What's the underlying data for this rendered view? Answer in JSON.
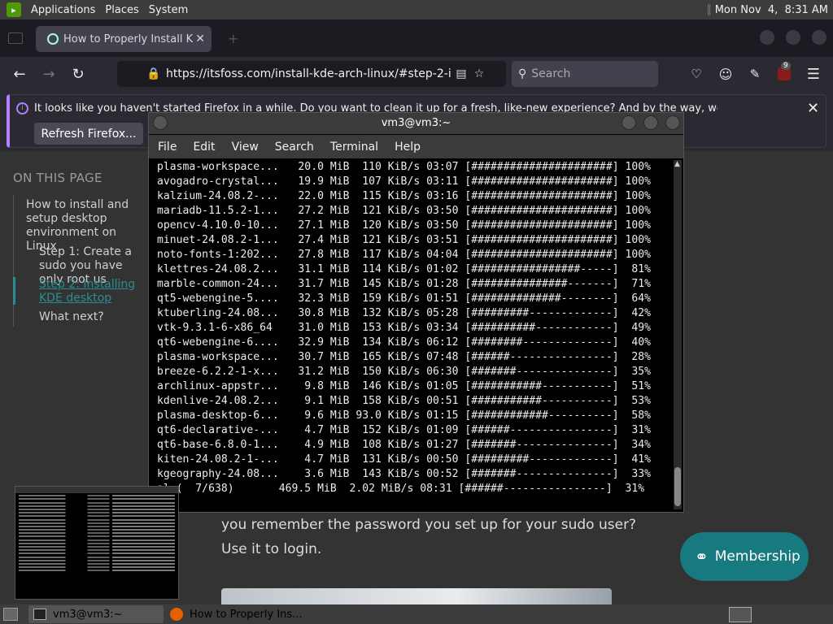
{
  "top_panel": {
    "menus": [
      "Applications",
      "Places",
      "System"
    ],
    "clock": "Mon Nov  4,  8:31 AM"
  },
  "browser": {
    "tab_title": "How to Properly Install KDE",
    "url": "https://itsfoss.com/install-kde-arch-linux/#step-2-instal",
    "search_placeholder": "Search",
    "badge_count": "9",
    "notification": "It looks like you haven't started Firefox in a while. Do you want to clean it up for a fresh, like-new experience? And by the way, welcome back!",
    "refresh_button": "Refresh Firefox..."
  },
  "page": {
    "toc_heading": "ON THIS PAGE",
    "toc_items": [
      "How to install and setup desktop environment on Linux",
      "Step 1: Create a sudo you have only root us",
      "Step 2: Installing KDE desktop",
      "What next?"
    ],
    "body_line1": "you remember the password you set up for your sudo user?",
    "body_line2": "Use it to login.",
    "membership_label": "Membership"
  },
  "terminal": {
    "title": "vm3@vm3:~",
    "menu": [
      "File",
      "Edit",
      "View",
      "Search",
      "Terminal",
      "Help"
    ],
    "lines": [
      {
        "name": "plasma-workspace...",
        "size": "20.0 MiB",
        "speed": "110 KiB/s",
        "eta": "03:07",
        "bar": "[######################]",
        "pct": "100%"
      },
      {
        "name": "avogadro-crystal...",
        "size": "19.9 MiB",
        "speed": "107 KiB/s",
        "eta": "03:11",
        "bar": "[######################]",
        "pct": "100%"
      },
      {
        "name": "kalzium-24.08.2-...",
        "size": "22.0 MiB",
        "speed": "115 KiB/s",
        "eta": "03:16",
        "bar": "[######################]",
        "pct": "100%"
      },
      {
        "name": "mariadb-11.5.2-1...",
        "size": "27.2 MiB",
        "speed": "121 KiB/s",
        "eta": "03:50",
        "bar": "[######################]",
        "pct": "100%"
      },
      {
        "name": "opencv-4.10.0-10...",
        "size": "27.1 MiB",
        "speed": "120 KiB/s",
        "eta": "03:50",
        "bar": "[######################]",
        "pct": "100%"
      },
      {
        "name": "minuet-24.08.2-1...",
        "size": "27.4 MiB",
        "speed": "121 KiB/s",
        "eta": "03:51",
        "bar": "[######################]",
        "pct": "100%"
      },
      {
        "name": "noto-fonts-1:202...",
        "size": "27.8 MiB",
        "speed": "117 KiB/s",
        "eta": "04:04",
        "bar": "[######################]",
        "pct": "100%"
      },
      {
        "name": "klettres-24.08.2...",
        "size": "31.1 MiB",
        "speed": "114 KiB/s",
        "eta": "01:02",
        "bar": "[#################-----]",
        "pct": "81%"
      },
      {
        "name": "marble-common-24...",
        "size": "31.7 MiB",
        "speed": "145 KiB/s",
        "eta": "01:28",
        "bar": "[###############-------]",
        "pct": "71%"
      },
      {
        "name": "qt5-webengine-5....",
        "size": "32.3 MiB",
        "speed": "159 KiB/s",
        "eta": "01:51",
        "bar": "[##############--------]",
        "pct": "64%"
      },
      {
        "name": "ktuberling-24.08...",
        "size": "30.8 MiB",
        "speed": "132 KiB/s",
        "eta": "05:28",
        "bar": "[#########-------------]",
        "pct": "42%"
      },
      {
        "name": "vtk-9.3.1-6-x86_64",
        "size": "31.0 MiB",
        "speed": "153 KiB/s",
        "eta": "03:34",
        "bar": "[##########------------]",
        "pct": "49%"
      },
      {
        "name": "qt6-webengine-6....",
        "size": "32.9 MiB",
        "speed": "134 KiB/s",
        "eta": "06:12",
        "bar": "[########--------------]",
        "pct": "40%"
      },
      {
        "name": "plasma-workspace...",
        "size": "30.7 MiB",
        "speed": "165 KiB/s",
        "eta": "07:48",
        "bar": "[######----------------]",
        "pct": "28%"
      },
      {
        "name": "breeze-6.2.2-1-x...",
        "size": "31.2 MiB",
        "speed": "150 KiB/s",
        "eta": "06:30",
        "bar": "[#######---------------]",
        "pct": "35%"
      },
      {
        "name": "archlinux-appstr...",
        "size": "9.8 MiB",
        "speed": "146 KiB/s",
        "eta": "01:05",
        "bar": "[###########-----------]",
        "pct": "51%"
      },
      {
        "name": "kdenlive-24.08.2...",
        "size": "9.1 MiB",
        "speed": "158 KiB/s",
        "eta": "00:51",
        "bar": "[###########-----------]",
        "pct": "53%"
      },
      {
        "name": "plasma-desktop-6...",
        "size": "9.6 MiB",
        "speed": "93.0 KiB/s",
        "eta": "01:15",
        "bar": "[############----------]",
        "pct": "58%"
      },
      {
        "name": "qt6-declarative-...",
        "size": "4.7 MiB",
        "speed": "152 KiB/s",
        "eta": "01:09",
        "bar": "[######----------------]",
        "pct": "31%"
      },
      {
        "name": "qt6-base-6.8.0-1...",
        "size": "4.9 MiB",
        "speed": "108 KiB/s",
        "eta": "01:27",
        "bar": "[#######---------------]",
        "pct": "34%"
      },
      {
        "name": "kiten-24.08.2-1-...",
        "size": "4.7 MiB",
        "speed": "131 KiB/s",
        "eta": "00:50",
        "bar": "[#########-------------]",
        "pct": "41%"
      },
      {
        "name": "kgeography-24.08...",
        "size": "3.6 MiB",
        "speed": "143 KiB/s",
        "eta": "00:52",
        "bar": "[#######---------------]",
        "pct": "33%"
      }
    ],
    "total_line": "al (  7/638)       469.5 MiB  2.02 MiB/s 08:31 [######----------------]  31%"
  },
  "taskbar": {
    "terminal_task": "vm3@vm3:~",
    "firefox_task": "How to Properly Ins..."
  },
  "colors": {
    "accent_teal": "#177a80",
    "notif_purple": "#b381ff"
  }
}
